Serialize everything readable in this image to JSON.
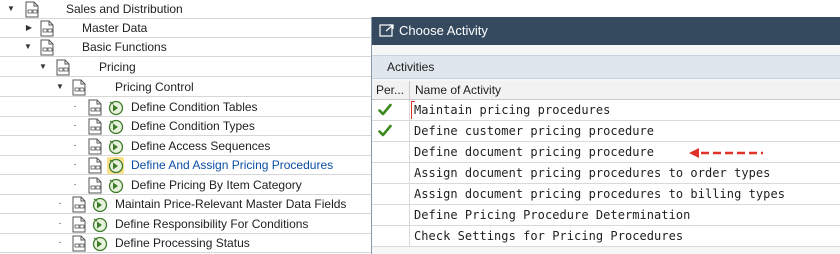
{
  "tree": {
    "items": [
      {
        "label": "Sales and Distribution",
        "expanded": true,
        "execute": false
      },
      {
        "label": "Master Data",
        "expanded": false,
        "execute": false
      },
      {
        "label": "Basic Functions",
        "expanded": true,
        "execute": false
      },
      {
        "label": "Pricing",
        "expanded": true,
        "execute": false
      },
      {
        "label": "Pricing Control",
        "expanded": true,
        "execute": false
      },
      {
        "label": "Define Condition Tables",
        "execute": true
      },
      {
        "label": "Define Condition Types",
        "execute": true
      },
      {
        "label": "Define Access Sequences",
        "execute": true
      },
      {
        "label": "Define And Assign Pricing Procedures",
        "execute": true,
        "selected": true
      },
      {
        "label": "Define Pricing By Item Category",
        "execute": true
      },
      {
        "label": "Maintain Price-Relevant Master Data Fields",
        "execute": true
      },
      {
        "label": "Define Responsibility For Conditions",
        "execute": true
      },
      {
        "label": "Define Processing Status",
        "execute": true
      }
    ]
  },
  "dialog": {
    "title": "Choose Activity",
    "section_label": "Activities",
    "columns": {
      "performed": "Per...",
      "name": "Name of Activity"
    },
    "rows": [
      {
        "name": "Maintain pricing procedures",
        "performed": true
      },
      {
        "name": "Define customer pricing procedure",
        "performed": true
      },
      {
        "name": "Define document pricing procedure",
        "performed": false
      },
      {
        "name": "Assign document pricing procedures to order types",
        "performed": false
      },
      {
        "name": "Assign document pricing procedures to billing types",
        "performed": false
      },
      {
        "name": "Define Pricing Procedure Determination",
        "performed": false
      },
      {
        "name": "Check Settings for Pricing Procedures",
        "performed": false
      }
    ]
  },
  "colors": {
    "title_bar": "#354a5f",
    "check_green": "#3a8a1e",
    "annotation_red": "#e0312b",
    "selected_highlight": "#fbe18a"
  }
}
